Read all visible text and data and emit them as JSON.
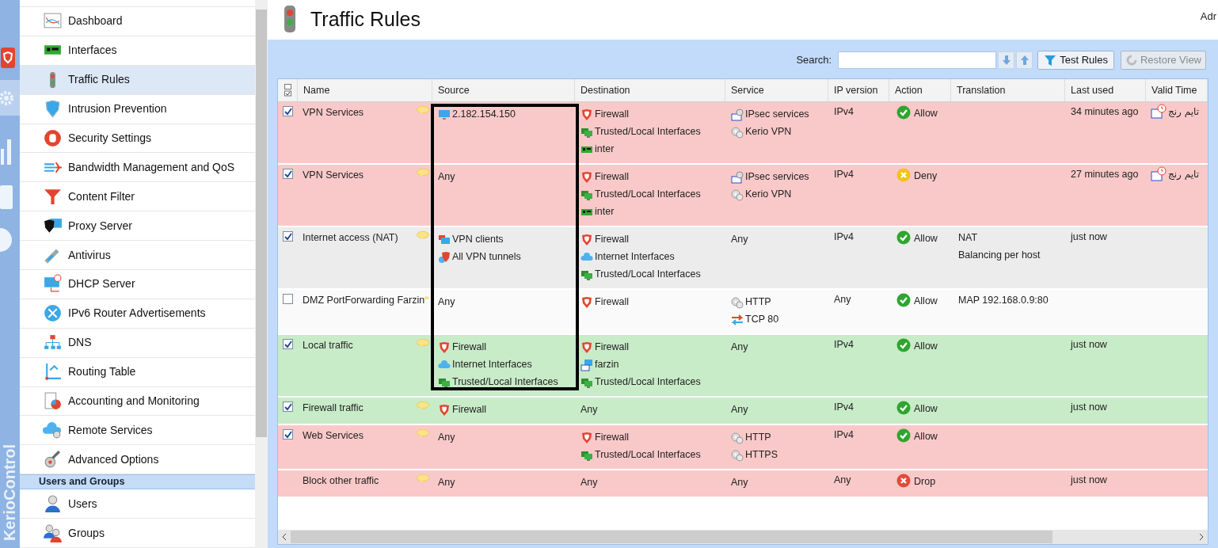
{
  "brand": "KerioControl",
  "sidebar": {
    "items": [
      {
        "label": "Dashboard",
        "selected": false
      },
      {
        "label": "Interfaces",
        "selected": false
      },
      {
        "label": "Traffic Rules",
        "selected": true
      },
      {
        "label": "Intrusion Prevention",
        "selected": false
      },
      {
        "label": "Security Settings",
        "selected": false
      },
      {
        "label": "Bandwidth Management and QoS",
        "selected": false
      },
      {
        "label": "Content Filter",
        "selected": false
      },
      {
        "label": "Proxy Server",
        "selected": false
      },
      {
        "label": "Antivirus",
        "selected": false
      },
      {
        "label": "DHCP Server",
        "selected": false
      },
      {
        "label": "IPv6 Router Advertisements",
        "selected": false
      },
      {
        "label": "DNS",
        "selected": false
      },
      {
        "label": "Routing Table",
        "selected": false
      },
      {
        "label": "Accounting and Monitoring",
        "selected": false
      },
      {
        "label": "Remote Services",
        "selected": false
      },
      {
        "label": "Advanced Options",
        "selected": false
      }
    ],
    "section": {
      "title": "Users and Groups",
      "items": [
        {
          "label": "Users",
          "selected": false
        },
        {
          "label": "Groups",
          "selected": false
        }
      ]
    }
  },
  "header": {
    "title": "Traffic Rules",
    "user": "Adr"
  },
  "toolbar": {
    "search_label": "Search:",
    "test_button": "Test Rules",
    "restore_button": {
      "label": "Restore View",
      "disabled": true
    }
  },
  "table": {
    "columns": [
      "Name",
      "Source",
      "Destination",
      "Service",
      "IP version",
      "Action",
      "Translation",
      "Last used",
      "Valid Time"
    ],
    "rows": [
      {
        "kind": "rule",
        "checked": true,
        "color": "#f9c9c9",
        "name": "VPN Services",
        "source": [
          {
            "kind": "host",
            "text": "2.182.154.150"
          }
        ],
        "destination": [
          {
            "kind": "firewall",
            "text": "Firewall"
          },
          {
            "kind": "trusted",
            "text": "Trusted/Local Interfaces"
          },
          {
            "kind": "interface",
            "text": "inter"
          }
        ],
        "service": [
          {
            "kind": "service-group",
            "text": "IPsec services"
          },
          {
            "kind": "service",
            "text": "Kerio VPN"
          }
        ],
        "ip_version": "IPv4",
        "action": {
          "kind": "allow",
          "text": "Allow"
        },
        "translation": [],
        "last_used": "34 minutes ago",
        "valid_time": {
          "kind": "time-range",
          "text": "تایم رنج"
        }
      },
      {
        "kind": "rule",
        "checked": true,
        "color": "#f9c9c9",
        "name": "VPN Services",
        "source": [
          {
            "kind": "plain",
            "text": "Any"
          }
        ],
        "destination": [
          {
            "kind": "firewall",
            "text": "Firewall"
          },
          {
            "kind": "trusted",
            "text": "Trusted/Local Interfaces"
          },
          {
            "kind": "interface",
            "text": "inter"
          }
        ],
        "service": [
          {
            "kind": "service-group",
            "text": "IPsec services"
          },
          {
            "kind": "service",
            "text": "Kerio VPN"
          }
        ],
        "ip_version": "IPv4",
        "action": {
          "kind": "deny",
          "text": "Deny"
        },
        "translation": [],
        "last_used": "27 minutes ago",
        "valid_time": {
          "kind": "time-range",
          "text": "تایم رنج"
        }
      },
      {
        "kind": "rule",
        "checked": true,
        "color": "#ececec",
        "name": "Internet access (NAT)",
        "source": [
          {
            "kind": "vpn-clients",
            "text": "VPN clients"
          },
          {
            "kind": "vpn-tunnels",
            "text": "All VPN tunnels"
          }
        ],
        "destination": [
          {
            "kind": "firewall",
            "text": "Firewall"
          },
          {
            "kind": "internet",
            "text": "Internet Interfaces"
          },
          {
            "kind": "trusted",
            "text": "Trusted/Local Interfaces"
          }
        ],
        "service": [
          {
            "kind": "plain",
            "text": "Any"
          }
        ],
        "ip_version": "IPv4",
        "action": {
          "kind": "allow",
          "text": "Allow"
        },
        "translation": [
          "NAT",
          "Balancing per host"
        ],
        "last_used": "just now"
      },
      {
        "kind": "rule",
        "checked": false,
        "color": "#fafafa",
        "name": "DMZ PortForwarding Farzin",
        "source": [
          {
            "kind": "plain",
            "text": "Any"
          }
        ],
        "destination": [
          {
            "kind": "firewall",
            "text": "Firewall"
          }
        ],
        "service": [
          {
            "kind": "service",
            "text": "HTTP"
          },
          {
            "kind": "port",
            "text": "TCP 80"
          }
        ],
        "ip_version": "Any",
        "action": {
          "kind": "allow",
          "text": "Allow"
        },
        "translation": [
          "MAP 192.168.0.9:80"
        ]
      },
      {
        "kind": "rule",
        "checked": true,
        "color": "#c8ebc8",
        "name": "Local traffic",
        "source": [
          {
            "kind": "firewall",
            "text": "Firewall"
          },
          {
            "kind": "internet",
            "text": "Internet Interfaces"
          },
          {
            "kind": "trusted",
            "text": "Trusted/Local Interfaces"
          }
        ],
        "destination": [
          {
            "kind": "firewall",
            "text": "Firewall"
          },
          {
            "kind": "address-group",
            "text": "farzin"
          },
          {
            "kind": "trusted",
            "text": "Trusted/Local Interfaces"
          }
        ],
        "service": [
          {
            "kind": "plain",
            "text": "Any"
          }
        ],
        "ip_version": "IPv4",
        "action": {
          "kind": "allow",
          "text": "Allow"
        },
        "translation": [],
        "last_used": "just now"
      },
      {
        "kind": "rule",
        "checked": true,
        "color": "#c8ebc8",
        "name": "Firewall traffic",
        "source": [
          {
            "kind": "firewall",
            "text": "Firewall"
          }
        ],
        "destination": [
          {
            "kind": "plain",
            "text": "Any"
          }
        ],
        "service": [
          {
            "kind": "plain",
            "text": "Any"
          }
        ],
        "ip_version": "IPv4",
        "action": {
          "kind": "allow",
          "text": "Allow"
        },
        "translation": [],
        "last_used": "just now"
      },
      {
        "kind": "rule",
        "checked": true,
        "color": "#f9c9c9",
        "name": "Web Services",
        "source": [
          {
            "kind": "plain",
            "text": "Any"
          }
        ],
        "destination": [
          {
            "kind": "firewall",
            "text": "Firewall"
          },
          {
            "kind": "trusted",
            "text": "Trusted/Local Interfaces"
          }
        ],
        "service": [
          {
            "kind": "service",
            "text": "HTTP"
          },
          {
            "kind": "service",
            "text": "HTTPS"
          }
        ],
        "ip_version": "IPv4",
        "action": {
          "kind": "allow",
          "text": "Allow"
        },
        "translation": []
      },
      {
        "kind": "default",
        "color": "#f9c9c9",
        "name": "Block other traffic",
        "source": [
          {
            "kind": "plain",
            "text": "Any"
          }
        ],
        "destination": [
          {
            "kind": "plain",
            "text": "Any"
          }
        ],
        "service": [
          {
            "kind": "plain",
            "text": "Any"
          }
        ],
        "ip_version": "Any",
        "action": {
          "kind": "drop",
          "text": "Drop"
        },
        "translation": [],
        "last_used": "just now"
      }
    ]
  }
}
